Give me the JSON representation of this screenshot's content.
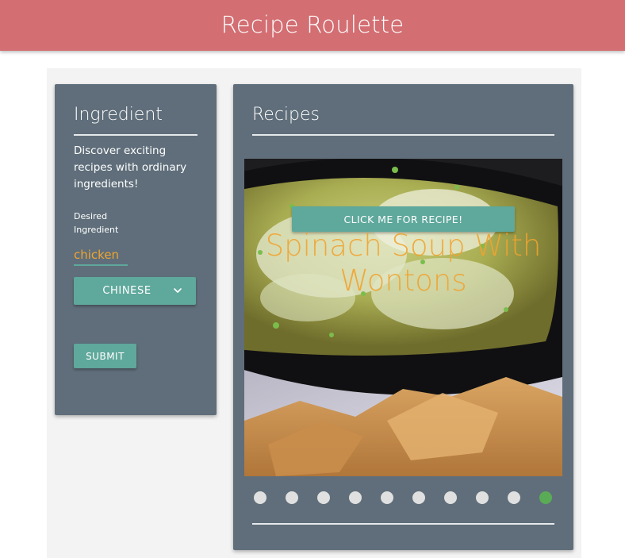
{
  "app": {
    "title": "Recipe Roulette",
    "header_color": "#d36e72",
    "accent_color": "#5fa89c",
    "highlight_color": "#f0a430"
  },
  "ingredient_panel": {
    "heading": "Ingredient",
    "intro": "Discover exciting recipes with ordinary ingredients!",
    "field_label": "Desired Ingredient",
    "ingredient_value": "chicken",
    "cuisine_selected": "CHINESE",
    "submit_label": "SUBMIT"
  },
  "recipes_panel": {
    "heading": "Recipes",
    "recipe_button_label": "CLICK ME FOR RECIPE!",
    "recipe_title": "Spinach Soup With Wontons",
    "slide_count": 10,
    "active_slide": 10
  },
  "icons": {
    "cuisine_dropdown": "chevron-down-icon"
  }
}
